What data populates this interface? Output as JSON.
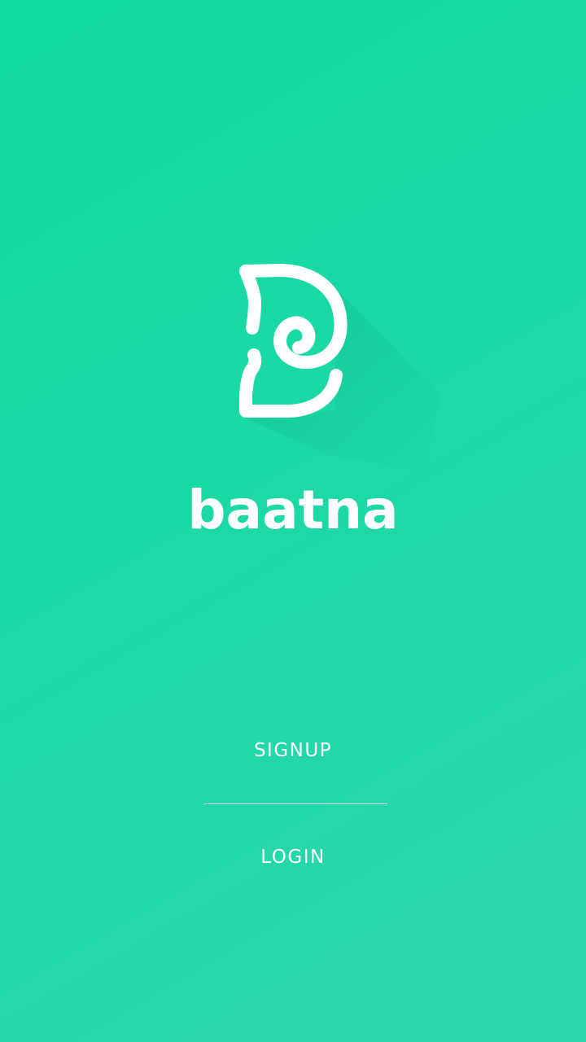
{
  "app": {
    "name": "baatna"
  },
  "actions": {
    "signup_label": "SIGNUP",
    "login_label": "LOGIN"
  },
  "icons": {
    "logo": "baatna-b-logo-icon"
  },
  "colors": {
    "background_start": "#10DA9E",
    "background_end": "#2CD6AB",
    "foreground": "#FFFFFF"
  }
}
